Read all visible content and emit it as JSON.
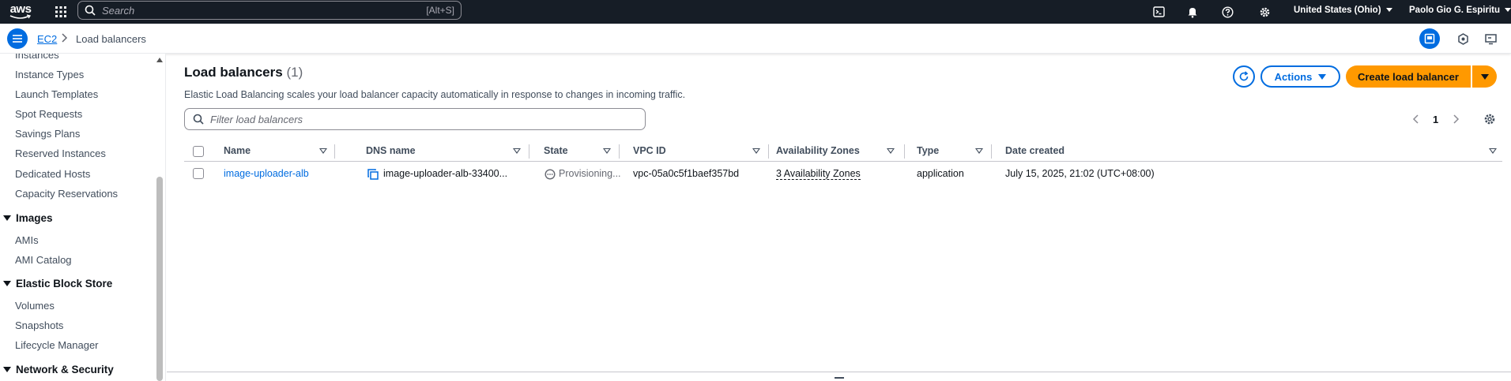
{
  "topnav": {
    "logo_text": "aws",
    "search_placeholder": "Search",
    "search_shortcut": "[Alt+S]",
    "region": "United States (Ohio)",
    "user": "Paolo Gio G. Espiritu",
    "icons": [
      "cloudshell-icon",
      "bell-icon",
      "help-icon",
      "gear-icon"
    ]
  },
  "breadcrumb": {
    "root": "EC2",
    "current": "Load balancers"
  },
  "sidebar": {
    "partial_item": "Instances",
    "instances_items": [
      "Instance Types",
      "Launch Templates",
      "Spot Requests",
      "Savings Plans",
      "Reserved Instances",
      "Dedicated Hosts",
      "Capacity Reservations"
    ],
    "images_header": "Images",
    "images_items": [
      "AMIs",
      "AMI Catalog"
    ],
    "ebs_header": "Elastic Block Store",
    "ebs_items": [
      "Volumes",
      "Snapshots",
      "Lifecycle Manager"
    ],
    "netsec_header": "Network & Security"
  },
  "main": {
    "title": "Load balancers",
    "count": "(1)",
    "description": "Elastic Load Balancing scales your load balancer capacity automatically in response to changes in incoming traffic.",
    "actions_label": "Actions",
    "create_label": "Create load balancer",
    "filter_placeholder": "Filter load balancers",
    "page_number": "1"
  },
  "table": {
    "columns": [
      "Name",
      "DNS name",
      "State",
      "VPC ID",
      "Availability Zones",
      "Type",
      "Date created"
    ],
    "rows": [
      {
        "name": "image-uploader-alb",
        "dns": "image-uploader-alb-33400...",
        "state": "Provisioning...",
        "vpc": "vpc-05a0c5f1baef357bd",
        "azs": "3 Availability Zones",
        "type": "application",
        "created": "July 15, 2025, 21:02 (UTC+08:00)"
      }
    ]
  },
  "colors": {
    "nav_bg": "#161d26",
    "link": "#006ce0",
    "primary_button": "#ff9900"
  }
}
